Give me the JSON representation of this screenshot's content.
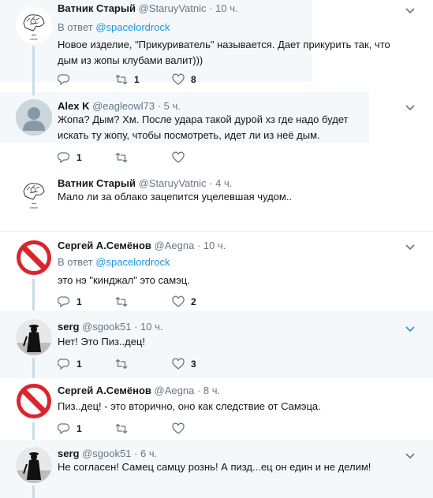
{
  "tweets": [
    {
      "name": "Ватник Старый",
      "handle": "@StaruyVatnic",
      "time": "10 ч.",
      "reply_prefix": "В ответ",
      "reply_link": "@spacelordrock",
      "text": "Новое изделие, \"Прикуриватель\" называется. Дает прикурить так, что дым из жопы клубами валит)))",
      "reply_count": "",
      "retweet_count": "1",
      "like_count": "8",
      "avatar": "sketch-avatar"
    },
    {
      "name": "Alex K",
      "handle": "@eagleowl73",
      "time": "5 ч.",
      "text": "Жопа? Дым? Хм. После удара такой дурой хз где надо будет искать ту жопу, чтобы посмотреть, идет ли из неё дым.",
      "reply_count": "1",
      "retweet_count": "",
      "like_count": "",
      "avatar": "default-avatar"
    },
    {
      "name": "Ватник Старый",
      "handle": "@StaruyVatnic",
      "time": "4 ч.",
      "text": "Мало ли за облако зацепится уцелевшая чудом..",
      "avatar": "sketch-avatar"
    },
    {
      "name": "Сергей А.Семёнов",
      "handle": "@Aegna",
      "time": "10 ч.",
      "reply_prefix": "В ответ",
      "reply_link": "@spacelordrock",
      "text": "это нэ \"кинджал\" это самэц.",
      "reply_count": "1",
      "retweet_count": "",
      "like_count": "2",
      "avatar": "no-entry-avatar"
    },
    {
      "name": "serg",
      "handle": "@sgook51",
      "time": "10 ч.",
      "text": "Нет! Это Пиз..дец!",
      "reply_count": "1",
      "retweet_count": "",
      "like_count": "3",
      "avatar": "silhouette-avatar"
    },
    {
      "name": "Сергей А.Семёнов",
      "handle": "@Aegna",
      "time": "8 ч.",
      "text": "Пиз..дец! - это вторично, оно как следствие от Самэца.",
      "reply_count": "1",
      "retweet_count": "",
      "like_count": "",
      "avatar": "no-entry-avatar"
    },
    {
      "name": "serg",
      "handle": "@sgook51",
      "time": "6 ч.",
      "text": "Не согласен! Самец самцу рознь! А пизд...ец он един и не делим!",
      "avatar": "silhouette-avatar"
    }
  ],
  "colors": {
    "highlight_bg": "#f5f8fa",
    "link": "#1b95e0",
    "muted": "#657786",
    "thread_line": "#c7dcea",
    "no_entry_red": "#d9262c"
  }
}
